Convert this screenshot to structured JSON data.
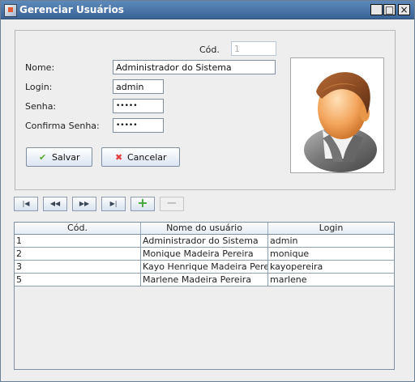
{
  "window": {
    "title": "Gerenciar Usuários",
    "controls": {
      "minimize": "_",
      "maximize": "□",
      "close": "×"
    }
  },
  "form": {
    "cod_label": "Cód.",
    "cod_value": "1",
    "nome_label": "Nome:",
    "nome_value": "Administrador do Sistema",
    "login_label": "Login:",
    "login_value": "admin",
    "senha_label": "Senha:",
    "senha_value": "•••••",
    "confirma_label": "Confirma Senha:",
    "confirma_value": "•••••",
    "salvar_label": "Salvar",
    "cancelar_label": "Cancelar",
    "salvar_icon": "✔",
    "cancelar_icon": "✖"
  },
  "navigation": {
    "first": "|◀",
    "previous": "◀◀",
    "next": "▶▶",
    "last": "▶|",
    "add": "+",
    "remove": "−"
  },
  "table": {
    "headers": [
      "Cód.",
      "Nome do usuário",
      "Login"
    ],
    "rows": [
      [
        "1",
        "Administrador do Sistema",
        "admin"
      ],
      [
        "2",
        "Monique Madeira Pereira",
        "monique"
      ],
      [
        "3",
        "Kayo Henrique Madeira Pereira",
        "kayopereira"
      ],
      [
        "5",
        "Marlene Madeira Pereira",
        "marlene"
      ]
    ]
  }
}
